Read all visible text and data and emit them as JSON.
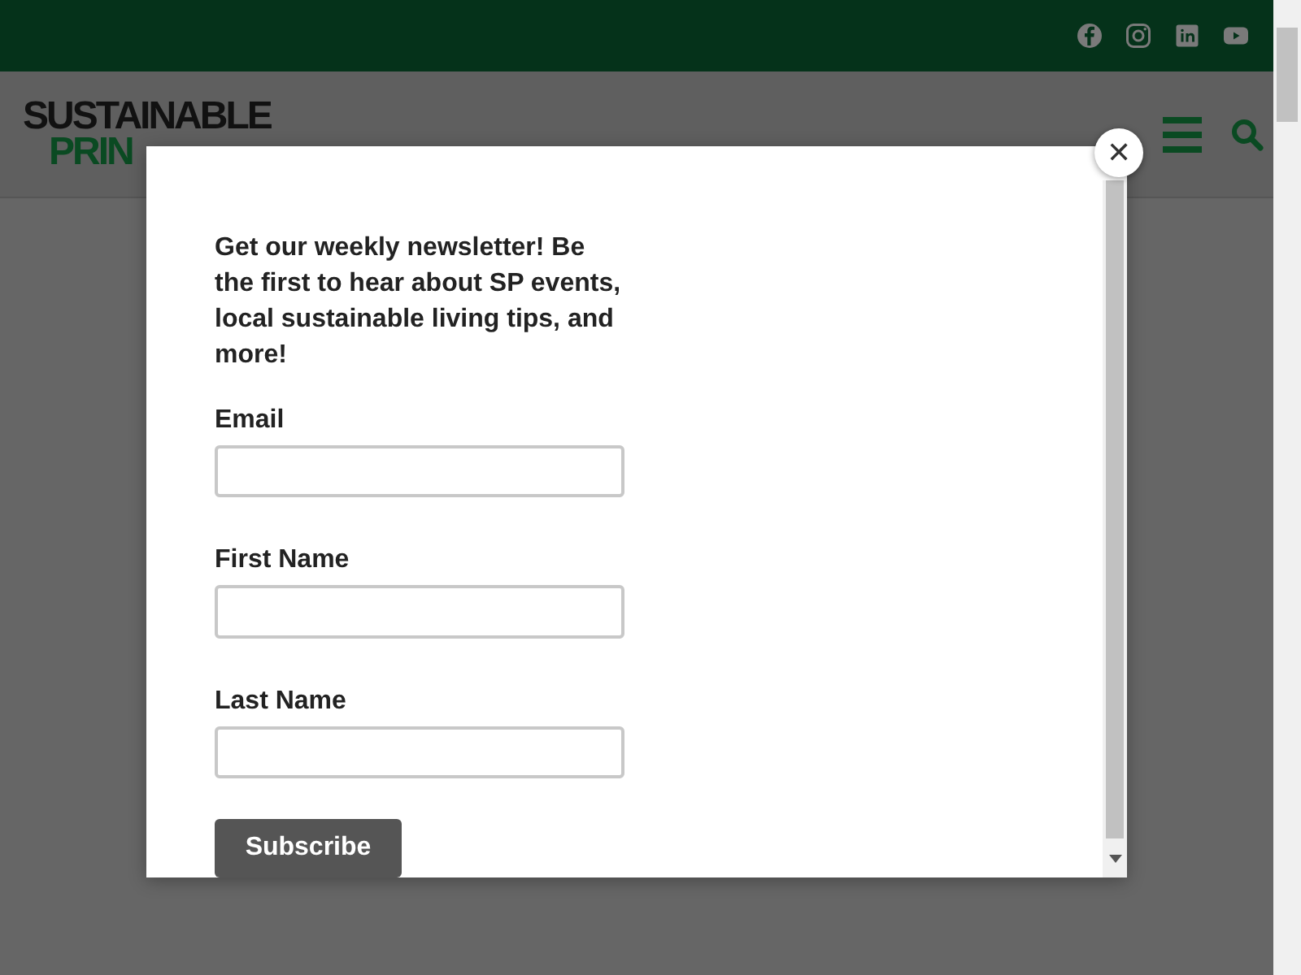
{
  "logo": {
    "line_1": "SUSTAINABLE",
    "line_2": "PRIN"
  },
  "modal": {
    "intro": "Get our weekly newsletter! Be the first to hear about SP events, local sustainable living tips, and more!",
    "fields": [
      {
        "label": "Email"
      },
      {
        "label": "First Name"
      },
      {
        "label": "Last Name"
      }
    ],
    "submit": "Subscribe",
    "close": "✕"
  }
}
